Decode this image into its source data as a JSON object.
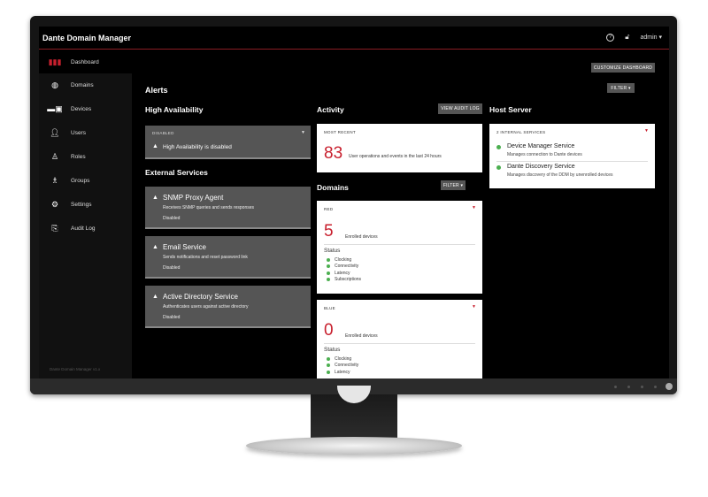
{
  "app": {
    "title": "Dante Domain Manager",
    "user": "admin ▾",
    "version": "Dante Domain Manager v1.x"
  },
  "sidebar": {
    "items": [
      {
        "label": "Dashboard",
        "icon": "bar-chart-icon"
      },
      {
        "label": "Domains",
        "icon": "globe-icon"
      },
      {
        "label": "Devices",
        "icon": "devices-icon"
      },
      {
        "label": "Users",
        "icon": "user-icon"
      },
      {
        "label": "Roles",
        "icon": "role-icon"
      },
      {
        "label": "Groups",
        "icon": "group-icon"
      },
      {
        "label": "Settings",
        "icon": "settings-icon"
      },
      {
        "label": "Audit Log",
        "icon": "audit-log-icon"
      }
    ]
  },
  "toolbar": {
    "customize": "CUSTOMIZE DASHBOARD",
    "filter": "FILTER ▾"
  },
  "alerts": {
    "title": "Alerts",
    "high_availability": {
      "title": "High Availability",
      "card_label": "DISABLED",
      "message": "High Availability is disabled"
    },
    "external_services": {
      "title": "External Services",
      "items": [
        {
          "name": "SNMP Proxy Agent",
          "desc": "Receives SNMP queries and sends responses",
          "state": "Disabled"
        },
        {
          "name": "Email Service",
          "desc": "Sends notifications and reset password link",
          "state": "Disabled"
        },
        {
          "name": "Active Directory Service",
          "desc": "Authenticates users against active directory",
          "state": "Disabled"
        }
      ]
    }
  },
  "activity": {
    "title": "Activity",
    "audit_button": "VIEW AUDIT LOG",
    "card_label": "MOST RECENT",
    "count": "83",
    "desc": "User operations and events in the last 24 hours"
  },
  "domains": {
    "title": "Domains",
    "filter": "FILTER ▾",
    "items": [
      {
        "name": "RED",
        "count": "5",
        "count_label": "Enrolled devices",
        "status_title": "Status",
        "statuses": [
          "Clocking",
          "Connectivity",
          "Latency",
          "Subscriptions"
        ]
      },
      {
        "name": "BLUE",
        "count": "0",
        "count_label": "Enrolled devices",
        "status_title": "Status",
        "statuses": [
          "Clocking",
          "Connectivity",
          "Latency"
        ]
      }
    ]
  },
  "host_server": {
    "title": "Host Server",
    "card_label": "2 INTERNAL SERVICES",
    "services": [
      {
        "name": "Device Manager Service",
        "desc": "Manages connection to Dante devices"
      },
      {
        "name": "Dante Discovery Service",
        "desc": "Manages discovery of the DDM by unenrolled devices"
      }
    ]
  },
  "colors": {
    "accent": "#c8202e",
    "ok": "#4caf50",
    "card_grey": "#555555"
  }
}
